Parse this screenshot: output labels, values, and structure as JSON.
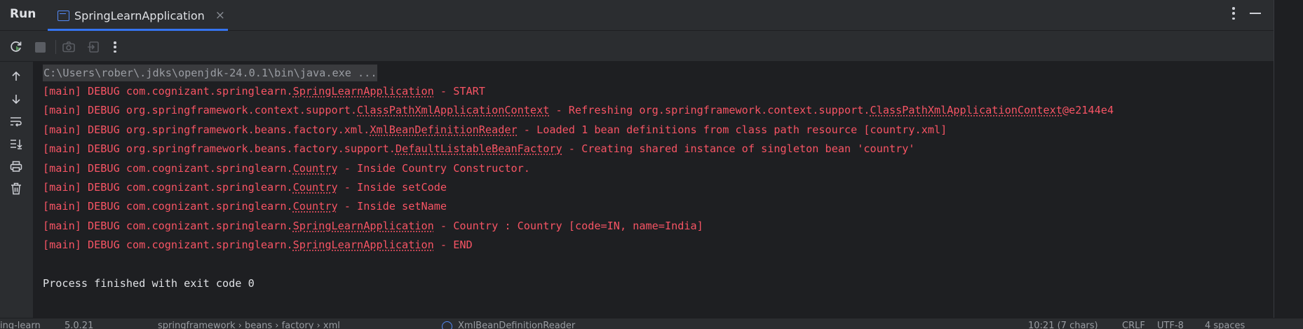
{
  "header": {
    "title": "Run",
    "tab_label": "SpringLearnApplication",
    "tab_close": "×"
  },
  "icons": {
    "toolbar": [
      "rerun-icon",
      "stop-icon",
      "camera-icon",
      "export-icon",
      "more-icon"
    ],
    "left_strip": [
      "scroll-up-icon",
      "scroll-down-icon",
      "soft-wrap-icon",
      "scroll-to-end-icon",
      "print-icon",
      "clear-all-icon"
    ]
  },
  "colors": {
    "accent": "#3574f0",
    "log_error": "#f75464",
    "background": "#1e1f22",
    "panel": "#2b2d30"
  },
  "console": {
    "command": "C:\\Users\\rober\\.jdks\\openjdk-24.0.1\\bin\\java.exe ...",
    "lines": [
      {
        "pre": "[main] DEBUG com.cognizant.springlearn.",
        "link": "SpringLearnApplication",
        "post": " - START"
      },
      {
        "pre": "[main] DEBUG org.springframework.context.support.",
        "link": "ClassPathXmlApplicationContext",
        "post": " - Refreshing org.springframework.context.support.",
        "link2": "ClassPathXmlApplicationContext",
        "post2": "@e2144e4"
      },
      {
        "pre": "[main] DEBUG org.springframework.beans.factory.xml.",
        "link": "XmlBeanDefinitionReader",
        "post": " - Loaded 1 bean definitions from class path resource [country.xml]"
      },
      {
        "pre": "[main] DEBUG org.springframework.beans.factory.support.",
        "link": "DefaultListableBeanFactory",
        "post": " - Creating shared instance of singleton bean 'country'"
      },
      {
        "pre": "[main] DEBUG com.cognizant.springlearn.",
        "link": "Country",
        "post": " - Inside Country Constructor."
      },
      {
        "pre": "[main] DEBUG com.cognizant.springlearn.",
        "link": "Country",
        "post": " - Inside setCode"
      },
      {
        "pre": "[main] DEBUG com.cognizant.springlearn.",
        "link": "Country",
        "post": " - Inside setName"
      },
      {
        "pre": "[main] DEBUG com.cognizant.springlearn.",
        "link": "SpringLearnApplication",
        "post": " - Country : Country [code=IN, name=India]"
      },
      {
        "pre": "[main] DEBUG com.cognizant.springlearn.",
        "link": "SpringLearnApplication",
        "post": " - END"
      }
    ],
    "exit": "Process finished with exit code 0"
  },
  "status_bar": {
    "left_fragment": "ing-learn",
    "version_fragment": "5.0.21",
    "path_fragment": "springframework › beans › factory › xml",
    "class_fragment": "XmlBeanDefinitionReader",
    "position_fragment": "10:21 (7 chars)",
    "line_sep": "CRLF",
    "encoding": "UTF-8",
    "indent": "4 spaces"
  }
}
